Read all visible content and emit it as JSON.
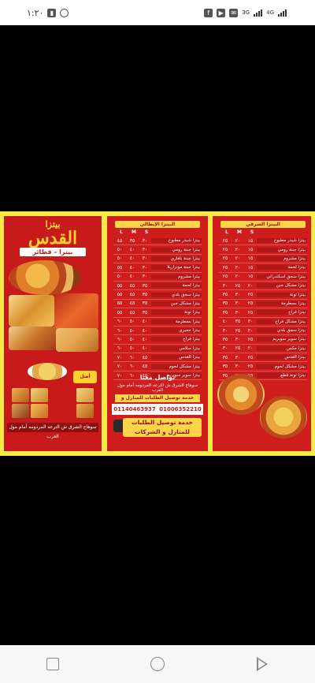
{
  "status_bar": {
    "time": "١:٢٠",
    "left_icons": [
      "alarm-icon",
      "battery-icon"
    ],
    "right_icons": [
      "facebook-icon",
      "youtube-icon",
      "signal-icon",
      "signal-icon"
    ],
    "network_labels": [
      "3G",
      "4G"
    ]
  },
  "brochure": {
    "brand_small": "بيتزا",
    "brand_big": "القدس",
    "subtitle": "بيتزا – فطائر",
    "badge": "أصل البيتزا",
    "address": "سوهاج الشرق ش الترعه المردومه أمام مول العرب"
  },
  "menu_left": {
    "heading": "البيتزا الإيطالي",
    "sizes": [
      "L",
      "M",
      "S"
    ],
    "items": [
      {
        "name": "بيتزا شيدر مطبوخ",
        "l": "٤٥",
        "m": "٣٥",
        "s": "٣٠"
      },
      {
        "name": "بيتزا جبنة رومي",
        "l": "٥٠",
        "m": "٤٠",
        "s": "٣٠"
      },
      {
        "name": "بيتزا جبنة بلغاري",
        "l": "٥٠",
        "m": "٤٠",
        "s": "٣٠"
      },
      {
        "name": "بيتزا جبنة موتزاريلا",
        "l": "٥٥",
        "m": "٤٠",
        "s": "٣٠"
      },
      {
        "name": "بيتزا مشروم",
        "l": "٥٠",
        "m": "٤٠",
        "s": "٣٠"
      },
      {
        "name": "بيتزا لحمة",
        "l": "٥٥",
        "m": "٤٥",
        "s": "٣٥"
      },
      {
        "name": "بيتزا سجق بلدي",
        "l": "٥٥",
        "m": "٤٥",
        "s": "٣٥"
      },
      {
        "name": "بيتزا مشكل جبن",
        "l": "٥٥",
        "m": "٤٥",
        "s": "٣٥"
      },
      {
        "name": "بيتزا تونة",
        "l": "٥٥",
        "m": "٤٥",
        "s": "٣٥"
      },
      {
        "name": "بيتزا بسطرمة",
        "l": "٦٠",
        "m": "٥٠",
        "s": "٤٠"
      },
      {
        "name": "بيتزا جمبري",
        "l": "٦٠",
        "m": "٥٠",
        "s": "٤٠"
      },
      {
        "name": "بيتزا فراخ",
        "l": "٦٠",
        "m": "٥٠",
        "s": "٤٠"
      },
      {
        "name": "بيتزا سلامي",
        "l": "٦٠",
        "m": "٥٠",
        "s": "٤٠"
      },
      {
        "name": "بيتزا القدس",
        "l": "٧٠",
        "m": "٦٠",
        "s": "٤٥"
      },
      {
        "name": "بيتزا مشكل لحوم",
        "l": "٧٠",
        "m": "٦٠",
        "s": "٤٥"
      },
      {
        "name": "بيتزا سوبر سوبريم",
        "l": "٧٠",
        "m": "٦٠",
        "s": "٤٥"
      }
    ],
    "contact_heading": "تواصل معنا",
    "contact_address": "سوهاج الشرق ش الترعه المردومه أمام مول العرب",
    "delivery_line": "خدمة توصيل الطلبات للمنازل و الشركات",
    "phones": [
      "01140463937",
      "01006352210"
    ],
    "delivery_big_1": "خدمة توصيل الطلبات",
    "delivery_big_2": "للمنازل و الشركات"
  },
  "menu_right": {
    "heading": "البيتزا الشرقي",
    "sizes": [
      "L",
      "M",
      "S"
    ],
    "items": [
      {
        "name": "بيتزا شيدر مطبوخ",
        "l": "٢٥",
        "m": "٢٠",
        "s": "١٥"
      },
      {
        "name": "بيتزا جبنة رومي",
        "l": "٢٥",
        "m": "٢٠",
        "s": "١٥"
      },
      {
        "name": "بيتزا مشروم",
        "l": "٢٥",
        "m": "٢٠",
        "s": "١٥"
      },
      {
        "name": "بيتزا لحمة",
        "l": "٢٥",
        "m": "٢٠",
        "s": "١٥"
      },
      {
        "name": "بيتزا سجق اسكندراني",
        "l": "٢٥",
        "m": "٢٠",
        "s": "١٥"
      },
      {
        "name": "بيتزا مشكل جبن",
        "l": "٣٠",
        "m": "٢٥",
        "s": "٢٠"
      },
      {
        "name": "بيتزا تونة",
        "l": "٣٥",
        "m": "٣٠",
        "s": "٢٥"
      },
      {
        "name": "بيتزا بسطرمة",
        "l": "٣٥",
        "m": "٣٠",
        "s": "٢٥"
      },
      {
        "name": "بيتزا فراخ",
        "l": "٣٥",
        "m": "٣٠",
        "s": "٢٥"
      },
      {
        "name": "بيتزا مشكل فراخ",
        "l": "٤٠",
        "m": "٣٥",
        "s": "٣٠"
      },
      {
        "name": "بيتزا سجق بلدي",
        "l": "٣٠",
        "m": "٢٥",
        "s": "٢٠"
      },
      {
        "name": "بيتزا سوبر سوبريم",
        "l": "٣٥",
        "m": "٣٠",
        "s": "٢٥"
      },
      {
        "name": "بيتزا مكس",
        "l": "٣٠",
        "m": "٢٥",
        "s": "٢٠"
      },
      {
        "name": "بيتزا القدس",
        "l": "٣٥",
        "m": "٣٠",
        "s": "٢٥"
      },
      {
        "name": "بيتزا مشكل لحوم",
        "l": "٣٥",
        "m": "٣٠",
        "s": "٢٥"
      },
      {
        "name": "بيتزا تونة قطع",
        "l": "٣٥",
        "m": "٣٠",
        "s": "٢٥"
      }
    ]
  },
  "nav_bar": {
    "buttons": [
      "recents-button",
      "home-button",
      "back-button"
    ]
  },
  "colors": {
    "menu_red": "#cf1d1d",
    "brochure_border": "#f6e948",
    "accent_yellow": "#ffd44a"
  }
}
